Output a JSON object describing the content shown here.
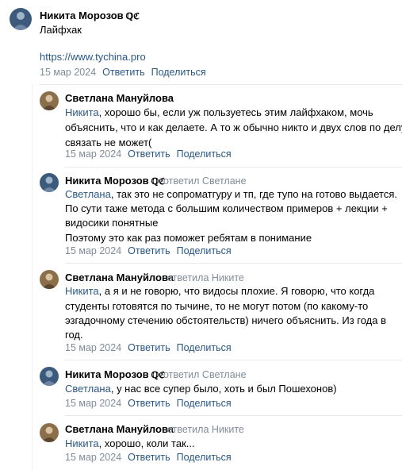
{
  "root": {
    "author": "Никита Морозов",
    "badge": "ℚℭ",
    "text": "Лайфхак",
    "url": "https://www.tychina.pro",
    "date": "15 мар 2024",
    "reply_label": "Ответить",
    "share_label": "Поделиться"
  },
  "replies": [
    {
      "author": "Светлана Мануйлова",
      "addressee": "Никита",
      "lines": [
        ", хорошо бы, если уж пользуетесь этим лайфхаком, мочь",
        "объяснить, что и как делаете. А то ж обычно никто и двух слов по делу",
        "связать не может("
      ],
      "date": "15 мар 2024",
      "reply_label": "Ответить",
      "share_label": "Поделиться"
    },
    {
      "author": "Никита Морозов",
      "badge": "ℚℭ",
      "reply_to": "ответил Светлане",
      "addressee": "Светлана",
      "lines": [
        ", так это не сопроматгуру и тп, где тупо на готово выдается.",
        "По сути таже метода с большим количеством примеров + лекции +",
        "видосики понятные",
        "Поэтому это как раз поможет ребятам в понимание"
      ],
      "date": "15 мар 2024",
      "reply_label": "Ответить",
      "share_label": "Поделиться"
    },
    {
      "author": "Светлана Мануйлова",
      "reply_to": "ответила Никите",
      "addressee": "Никита",
      "lines": [
        ", а я и не говорю, что видосы плохие. Я говорю, что когда",
        "студенты готовятся по тычине, то не могут потом (по какому-то",
        "эзгадочному стечению обстоятельств) ничего объяснить. Из года в",
        "год."
      ],
      "date": "15 мар 2024",
      "reply_label": "Ответить",
      "share_label": "Поделиться"
    },
    {
      "author": "Никита Морозов",
      "badge": "ℚℭ",
      "reply_to": "ответил Светлане",
      "addressee": "Светлана",
      "lines": [
        ", у нас все супер было, хоть и был Пошехонов)"
      ],
      "date": "15 мар 2024",
      "reply_label": "Ответить",
      "share_label": "Поделиться"
    },
    {
      "author": "Светлана Мануйлова",
      "reply_to": "ответила Никите",
      "addressee": "Никита",
      "lines": [
        ", хорошо, коли так..."
      ],
      "date": "15 мар 2024",
      "reply_label": "Ответить",
      "share_label": "Поделиться"
    }
  ]
}
